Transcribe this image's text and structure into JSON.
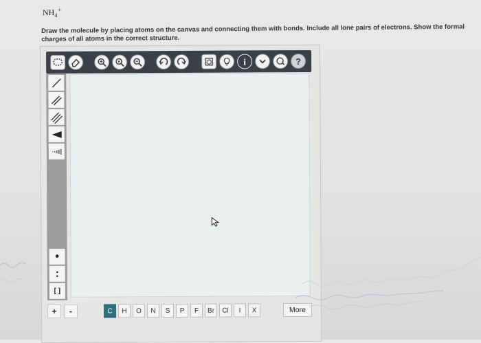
{
  "question": {
    "formula_main": "NH",
    "formula_subscript": "4",
    "formula_charge": "+",
    "instructions": "Draw the molecule by placing atoms on the canvas and connecting them with bonds. Include all lone pairs of electrons. Show the formal charges of all atoms in the correct structure."
  },
  "toolbar": {
    "info_symbol": "i",
    "help_symbol": "?"
  },
  "sidebar": {
    "brackets_symbol": "[ ]",
    "radical_symbol": "•",
    "lone_pair_symbol": ":"
  },
  "bottom_bar": {
    "plus_charge": "+",
    "minus_charge": "-",
    "elements": [
      "C",
      "H",
      "O",
      "N",
      "S",
      "P",
      "F",
      "Br",
      "Cl",
      "I",
      "X"
    ],
    "active_element": "C",
    "more_label": "More"
  },
  "colors": {
    "toolbar_bg": "#3c3f47",
    "active_element_bg": "#2f6f7a",
    "canvas_bg": "#eceff0"
  },
  "icons": {
    "toolbar": [
      "select-lasso-icon",
      "eraser-icon",
      "zoom-in-icon",
      "zoom-reset-icon",
      "zoom-out-icon",
      "undo-icon",
      "redo-icon",
      "template-icon",
      "hint-icon",
      "info-icon",
      "chevron-down-icon",
      "check-icon",
      "help-icon"
    ],
    "sidebar": [
      "single-bond-icon",
      "double-bond-icon",
      "triple-bond-icon",
      "wedge-bond-icon",
      "hash-bond-icon"
    ]
  }
}
